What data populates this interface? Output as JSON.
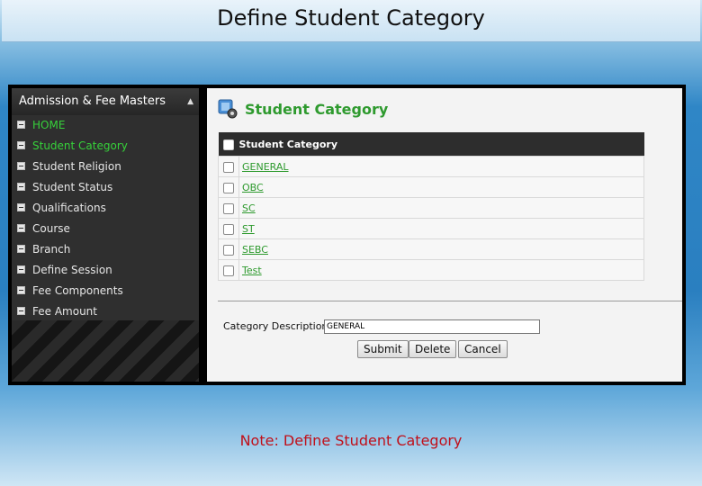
{
  "slide": {
    "title": "Define Student Category",
    "note": "Note: Define Student Category"
  },
  "sidebar": {
    "header": "Admission & Fee Masters",
    "items": [
      {
        "label": "HOME",
        "active": true
      },
      {
        "label": "Student Category",
        "active": true
      },
      {
        "label": "Student Religion",
        "active": false
      },
      {
        "label": "Student Status",
        "active": false
      },
      {
        "label": "Qualifications",
        "active": false
      },
      {
        "label": "Course",
        "active": false
      },
      {
        "label": "Branch",
        "active": false
      },
      {
        "label": "Define Session",
        "active": false
      },
      {
        "label": "Fee Components",
        "active": false
      },
      {
        "label": "Fee Amount",
        "active": false
      }
    ]
  },
  "main": {
    "heading": "Student Category",
    "table": {
      "header": "Student Category",
      "rows": [
        "GENERAL",
        "OBC",
        "SC",
        "ST",
        "SEBC",
        "Test"
      ]
    },
    "form": {
      "label": "Category Description:",
      "value": "GENERAL"
    },
    "buttons": {
      "submit": "Submit",
      "delete": "Delete",
      "cancel": "Cancel"
    }
  },
  "colors": {
    "accent_green": "#2e9a2e",
    "active_menu": "#36d13a",
    "note_red": "#c0101a"
  }
}
